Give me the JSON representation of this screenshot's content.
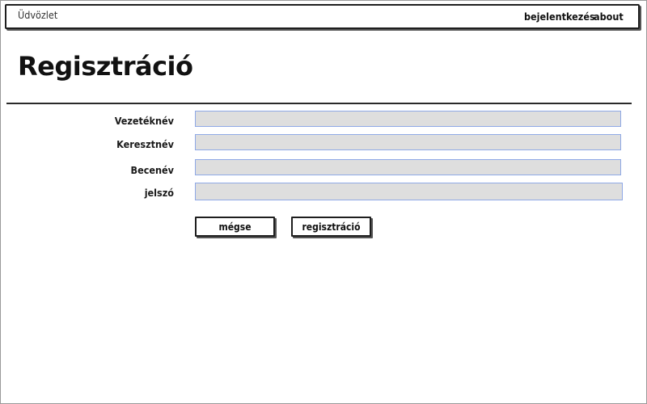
{
  "topbar": {
    "brand": "Üdvözlet",
    "nav": {
      "login": "bejelentkezés",
      "about": "about"
    }
  },
  "page": {
    "title": "Regisztráció"
  },
  "form": {
    "fields": [
      {
        "label": "Vezetéknév",
        "value": ""
      },
      {
        "label": "Keresztnév",
        "value": ""
      },
      {
        "label": "Becenév",
        "value": ""
      },
      {
        "label": "jelszó",
        "value": ""
      }
    ],
    "buttons": {
      "cancel": "mégse",
      "register": "regisztráció"
    }
  }
}
